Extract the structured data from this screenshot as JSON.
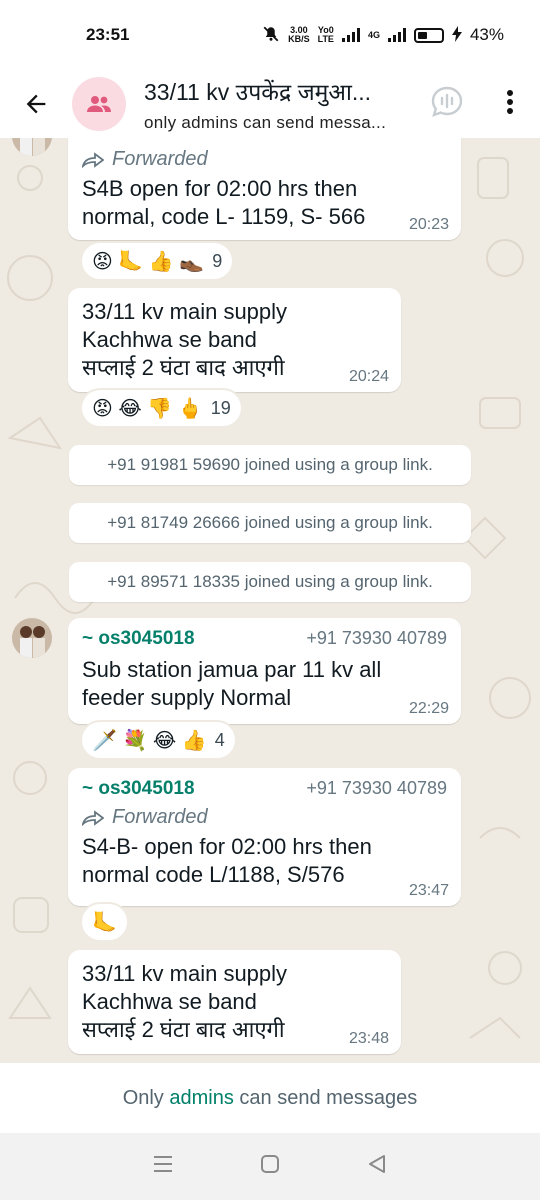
{
  "status_bar": {
    "time": "23:51",
    "net_speed": "3.00",
    "net_unit": "KB/S",
    "volte_top": "Yo0",
    "volte_bottom": "LTE",
    "network_type": "4G",
    "battery_percent": "43%"
  },
  "header": {
    "title": "33/11 kv उपकेंद्र जमुआ...",
    "subtitle": "only admins can send messa..."
  },
  "messages": [
    {
      "forwarded_label": "Forwarded",
      "text": "S4B open for 02:00 hrs then normal, code L- 1159, S- 566",
      "time": "20:23",
      "reactions": {
        "emojis": "😡 🦶 👍 👞",
        "count": "9"
      }
    },
    {
      "text": "33/11 kv  main supply\nKachhwa se band\nसप्लाई 2 घंटा बाद आएगी",
      "time": "20:24",
      "reactions": {
        "emojis": "😡 😂 👎 🖕",
        "count": "19"
      }
    },
    {
      "sender": "~ os3045018",
      "phone": "+91 73930 40789",
      "text": "Sub station jamua par 11 kv all feeder supply Normal",
      "time": "22:29",
      "reactions": {
        "emojis": "🗡️ 💐 😂 👍",
        "count": "4"
      }
    },
    {
      "sender": "~ os3045018",
      "phone": "+91 73930 40789",
      "forwarded_label": "Forwarded",
      "text": "S4-B- open for 02:00 hrs then normal code  L/1188, S/576",
      "time": "23:47",
      "reactions": {
        "emojis": "🦶"
      }
    },
    {
      "text": "33/11 kv  main supply\nKachhwa se band\nसप्लाई 2 घंटा बाद आएगी",
      "time": "23:48"
    }
  ],
  "system_messages": [
    "+91 91981 59690 joined using a group link.",
    "+91 81749 26666 joined using a group link.",
    "+91 89571 18335 joined using a group link."
  ],
  "footer": {
    "prefix": "Only ",
    "link": "admins",
    "suffix": " can send messages"
  },
  "colors": {
    "accent": "#008069",
    "sender_name": "#06806b",
    "chat_bg": "#efeae2",
    "avatar_bg": "#fbdbe2",
    "avatar_icon": "#e05a7d"
  },
  "icons": {
    "back": "arrow-left-icon",
    "group": "group-icon",
    "voice_chat": "voice-chat-icon",
    "menu": "more-vertical-icon",
    "forward": "forward-arrow-icon"
  }
}
